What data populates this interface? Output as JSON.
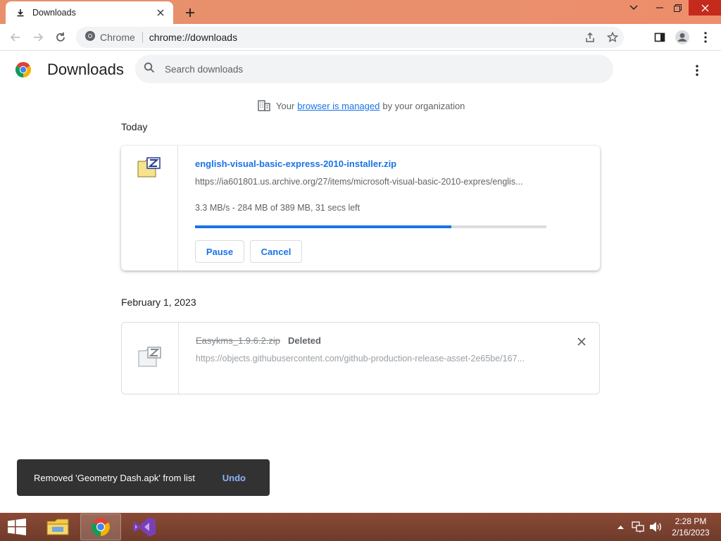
{
  "window": {
    "tab_title": "Downloads",
    "icons": {
      "tab": "download-icon",
      "close_tab": "close-icon",
      "new_tab": "plus-icon"
    }
  },
  "omnibox": {
    "site_label": "Chrome",
    "url": "chrome://downloads"
  },
  "page": {
    "title": "Downloads",
    "search_placeholder": "Search downloads",
    "managed": {
      "prefix": "Your",
      "link": "browser is managed",
      "suffix": "by your organization"
    }
  },
  "downloads": {
    "today": {
      "date": "Today",
      "item": {
        "file_name": "english-visual-basic-express-2010-installer.zip",
        "url": "https://ia601801.us.archive.org/27/items/microsoft-visual-basic-2010-expres/englis...",
        "status": "3.3 MB/s - 284 MB of 389 MB, 31 secs left",
        "progress_percent": 73,
        "pause_label": "Pause",
        "cancel_label": "Cancel"
      }
    },
    "earlier": {
      "date": "February 1, 2023",
      "item": {
        "file_name": "Easykms_1.9.6.2.zip",
        "tag": "Deleted",
        "url": "https://objects.githubusercontent.com/github-production-release-asset-2e65be/167..."
      }
    }
  },
  "toast": {
    "message": "Removed 'Geometry Dash.apk' from list",
    "undo_label": "Undo"
  },
  "taskbar": {
    "time": "2:28 PM",
    "date": "2/16/2023"
  },
  "colors": {
    "accent": "#1a73e8",
    "titlebar": "#e98f6c",
    "taskbar": "#7a4130",
    "toast": "#323232"
  }
}
